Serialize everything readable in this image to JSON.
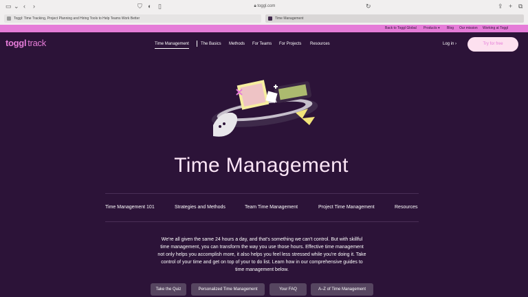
{
  "browser": {
    "address": "toggl.com",
    "tabs": [
      {
        "label": "Toggl: Time Tracking, Project Planning and Hiring Tools to Help Teams Work Better"
      },
      {
        "label": "Time Management"
      }
    ]
  },
  "topbar": {
    "links": [
      "Back to Toggl Global",
      "Products ▾",
      "Blog",
      "Our mission",
      "Working at Toggl"
    ]
  },
  "nav": {
    "logo_brand": "toggl",
    "logo_product": "track",
    "links": [
      "Time Management",
      "The Basics",
      "Methods",
      "For Teams",
      "For Projects",
      "Resources"
    ],
    "login": "Log in ›",
    "cta": "Try for free"
  },
  "page": {
    "title": "Time Management",
    "subnav": [
      "Time Management 101",
      "Strategies and Methods",
      "Team Time Management",
      "Project Time Management",
      "Resources"
    ],
    "intro": "We're all given the same 24 hours a day, and that's something we can't control. But with skillful time management, you can transform the way you use those hours. Effective time management not only helps you accomplish more, it also helps you feel less stressed while you're doing it. Take control of your time and get on top of your to do list. Learn how in our comprehensive guides to time management below.",
    "buttons": [
      "Take the Quiz",
      "Personalized Time Management",
      "Your FAQ",
      "A–Z of Time Management"
    ]
  },
  "colors": {
    "background": "#2c1338",
    "accent_pink": "#e57cd8",
    "button": "#564560",
    "title": "#fce5f6"
  },
  "icons": [
    "sidebar-icon",
    "chevron-left-icon",
    "chevron-right-icon",
    "shield-icon",
    "reader-icon",
    "lock-icon",
    "reload-icon",
    "share-icon",
    "plus-icon",
    "tabs-icon"
  ]
}
